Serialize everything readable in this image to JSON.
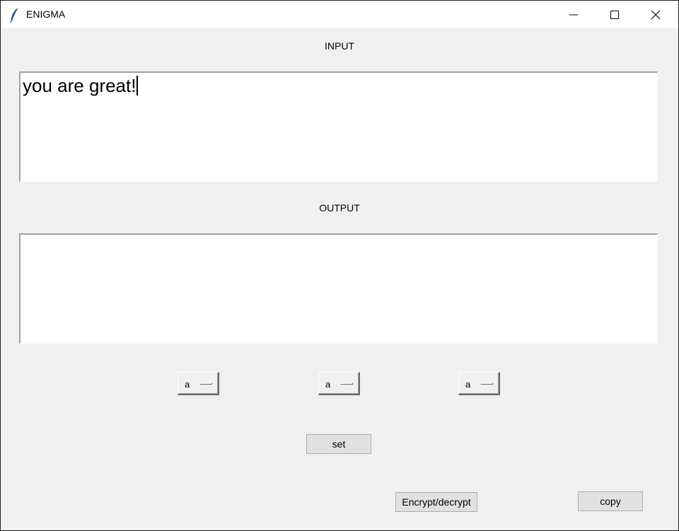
{
  "window": {
    "title": "ENIGMA",
    "icon": "feather-icon"
  },
  "controls": {
    "minimize": "minimize-icon",
    "maximize": "maximize-icon",
    "close": "close-icon"
  },
  "input": {
    "label": "INPUT",
    "value": "you are great!"
  },
  "output": {
    "label": "OUTPUT",
    "value": ""
  },
  "rotors": [
    {
      "value": "a"
    },
    {
      "value": "a"
    },
    {
      "value": "a"
    }
  ],
  "buttons": {
    "set": "set",
    "encrypt": "Encrypt/decrypt",
    "copy": "copy"
  }
}
